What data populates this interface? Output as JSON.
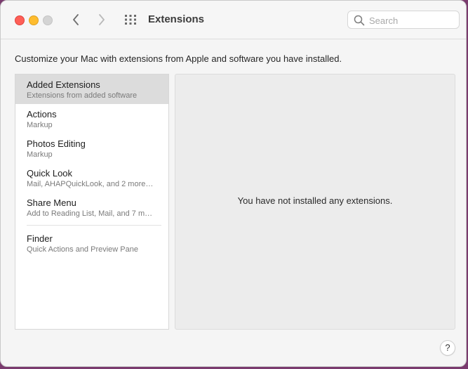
{
  "window": {
    "title": "Extensions",
    "description": "Customize your Mac with extensions from Apple and software you have installed."
  },
  "search": {
    "placeholder": "Search",
    "value": ""
  },
  "sidebar": {
    "items": [
      {
        "name": "Added Extensions",
        "sub": "Extensions from added software",
        "selected": true
      },
      {
        "name": "Actions",
        "sub": "Markup"
      },
      {
        "name": "Photos Editing",
        "sub": "Markup"
      },
      {
        "name": "Quick Look",
        "sub": "Mail, AHAPQuickLook, and 2 more…"
      },
      {
        "name": "Share Menu",
        "sub": "Add to Reading List, Mail, and 7 m…"
      },
      {
        "name": "Finder",
        "sub": "Quick Actions and Preview Pane"
      }
    ]
  },
  "content": {
    "message": "You have not installed any extensions."
  },
  "help": {
    "label": "?"
  },
  "colors": {
    "close": "#fe5f57",
    "minimize": "#febc2e",
    "zoom": "#d4d4d4",
    "selected_row": "#dcdcdc",
    "content_bg": "#ececec"
  },
  "icons": {
    "back": "chevron-left-icon",
    "forward": "chevron-right-icon",
    "grid": "grid-icon",
    "search": "magnifier-icon"
  }
}
